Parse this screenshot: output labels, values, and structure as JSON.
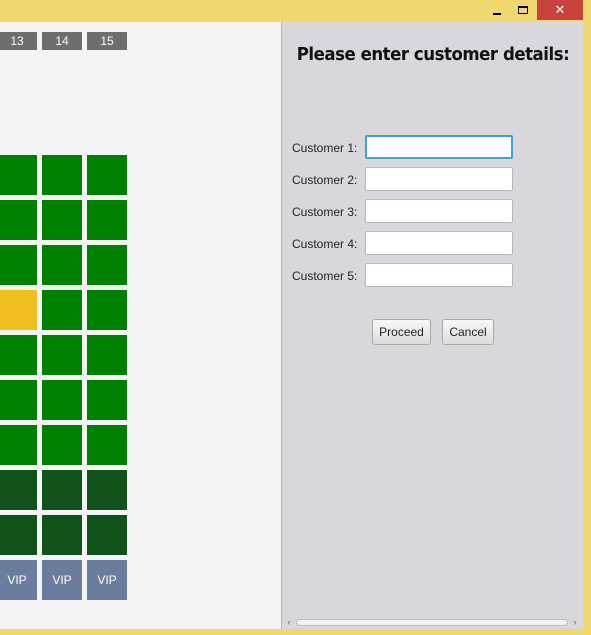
{
  "window": {
    "minimize_glyph": "",
    "maximize_glyph": "",
    "close_glyph": "✕"
  },
  "seating": {
    "column_headers": [
      "13",
      "14",
      "15"
    ],
    "vip_label": "VIP",
    "colors": {
      "available": "#008000",
      "selected": "#f0c020",
      "premium": "#11521a",
      "vip": "#6b7d9e",
      "header": "#6e6e6e"
    }
  },
  "form": {
    "title": "Please enter customer details:",
    "fields": [
      {
        "label": "Customer 1:",
        "value": ""
      },
      {
        "label": "Customer 2:",
        "value": ""
      },
      {
        "label": "Customer 3:",
        "value": ""
      },
      {
        "label": "Customer 4:",
        "value": ""
      },
      {
        "label": "Customer 5:",
        "value": ""
      }
    ],
    "proceed_label": "Proceed",
    "cancel_label": "Cancel"
  },
  "scrollbar": {
    "left_arrow": "‹",
    "right_arrow": "›"
  }
}
